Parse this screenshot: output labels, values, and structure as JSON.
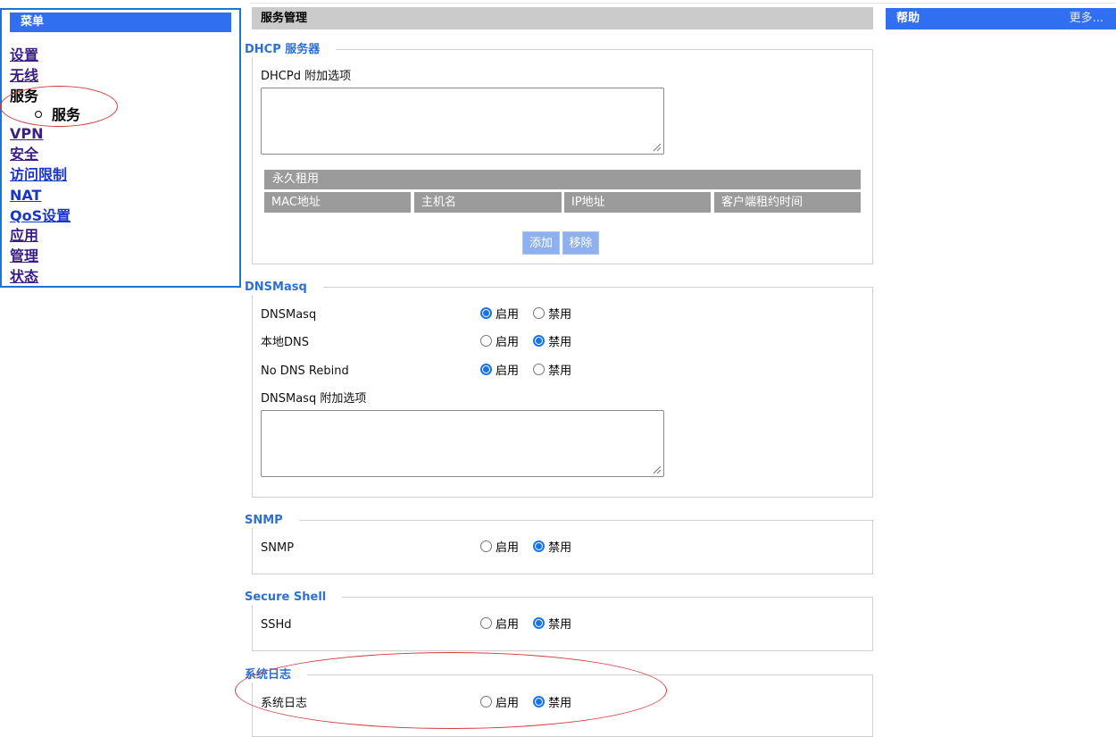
{
  "menu": {
    "title": "菜单",
    "items": [
      {
        "label": "设置"
      },
      {
        "label": "无线"
      },
      {
        "label": "服务",
        "sub": "服务"
      },
      {
        "label": "VPN"
      },
      {
        "label": "安全"
      },
      {
        "label": "访问限制"
      },
      {
        "label": "NAT"
      },
      {
        "label": "QoS设置"
      },
      {
        "label": "应用"
      },
      {
        "label": "管理"
      },
      {
        "label": "状态"
      }
    ]
  },
  "header": {
    "title": "服务管理"
  },
  "help": {
    "title": "帮助",
    "more": "更多..."
  },
  "dhcp": {
    "legend": "DHCP 服务器",
    "options_label": "DHCPd 附加选项",
    "options_value": "",
    "lease_title": "永久租用",
    "columns": [
      "MAC地址",
      "主机名",
      "IP地址",
      "客户端租约时间"
    ],
    "add_label": "添加",
    "remove_label": "移除"
  },
  "radio_labels": {
    "enable": "启用",
    "disable": "禁用"
  },
  "dnsmasq": {
    "legend": "DNSMasq",
    "rows": [
      {
        "label": "DNSMasq",
        "value": "enable"
      },
      {
        "label": "本地DNS",
        "value": "disable"
      },
      {
        "label": "No DNS Rebind",
        "value": "enable"
      }
    ],
    "options_label": "DNSMasq 附加选项",
    "options_value": ""
  },
  "snmp": {
    "legend": "SNMP",
    "label": "SNMP",
    "value": "disable"
  },
  "ssh": {
    "legend": "Secure Shell",
    "label": "SSHd",
    "value": "disable"
  },
  "syslog": {
    "legend": "系统日志",
    "label": "系统日志",
    "value": "disable"
  },
  "colors": {
    "accent": "#2f6ff0",
    "legend": "#2f6fd0",
    "annotation": "#d23b3b"
  }
}
